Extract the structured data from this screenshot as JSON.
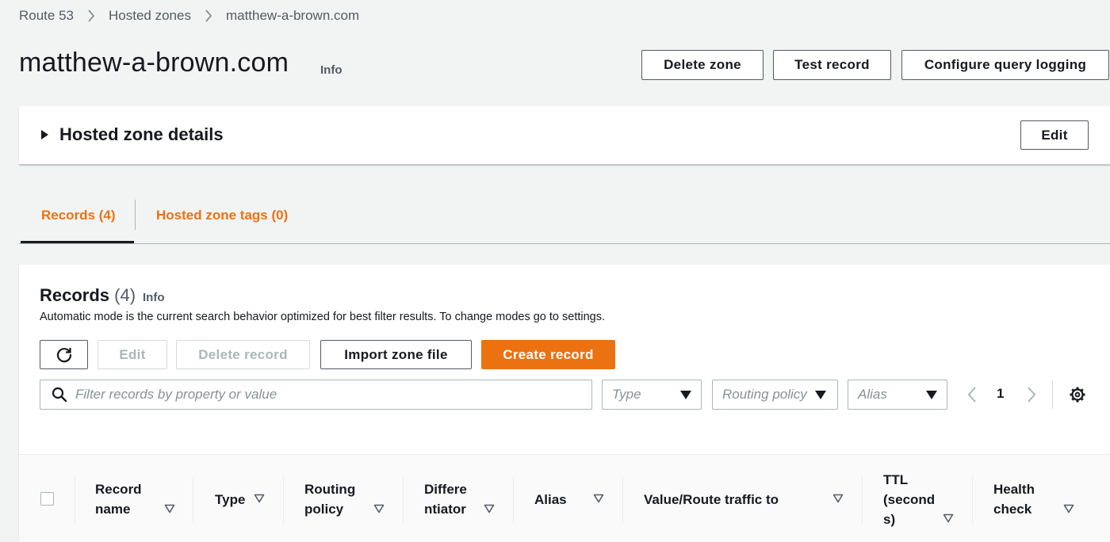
{
  "breadcrumb": {
    "items": [
      "Route 53",
      "Hosted zones"
    ],
    "current": "matthew-a-brown.com"
  },
  "page": {
    "title": "matthew-a-brown.com",
    "info": "Info"
  },
  "header_buttons": {
    "delete_zone": "Delete zone",
    "test_record": "Test record",
    "configure_query_logging": "Configure query logging"
  },
  "hosted_zone_details": {
    "title": "Hosted zone details",
    "edit": "Edit"
  },
  "tabs": [
    {
      "label": "Records (4)",
      "active": true
    },
    {
      "label": "Hosted zone tags (0)",
      "active": false
    }
  ],
  "records": {
    "title": "Records",
    "count": "(4)",
    "info": "Info",
    "description": "Automatic mode is the current search behavior optimized for best filter results. To change modes go to settings.",
    "buttons": {
      "edit": "Edit",
      "delete_record": "Delete record",
      "import_zone_file": "Import zone file",
      "create_record": "Create record"
    },
    "filter_placeholder": "Filter records by property or value",
    "selects": {
      "type": "Type",
      "routing_policy": "Routing policy",
      "alias": "Alias"
    },
    "page": "1",
    "columns": [
      {
        "line1": "Record",
        "line2": "name",
        "line3": ""
      },
      {
        "line1": "Type",
        "line2": "",
        "line3": ""
      },
      {
        "line1": "Routing",
        "line2": "policy",
        "line3": ""
      },
      {
        "line1": "Differe",
        "line2": "ntiator",
        "line3": ""
      },
      {
        "line1": "Alias",
        "line2": "",
        "line3": ""
      },
      {
        "line1": "Value/Route traffic to",
        "line2": "",
        "line3": ""
      },
      {
        "line1": "TTL",
        "line2": "(second",
        "line3": "s)"
      },
      {
        "line1": "Health",
        "line2": "check",
        "line3": ""
      }
    ]
  },
  "colors": {
    "accent": "#ec7211",
    "text": "#16191f",
    "secondary_text": "#545b64",
    "background": "#f2f3f3"
  }
}
